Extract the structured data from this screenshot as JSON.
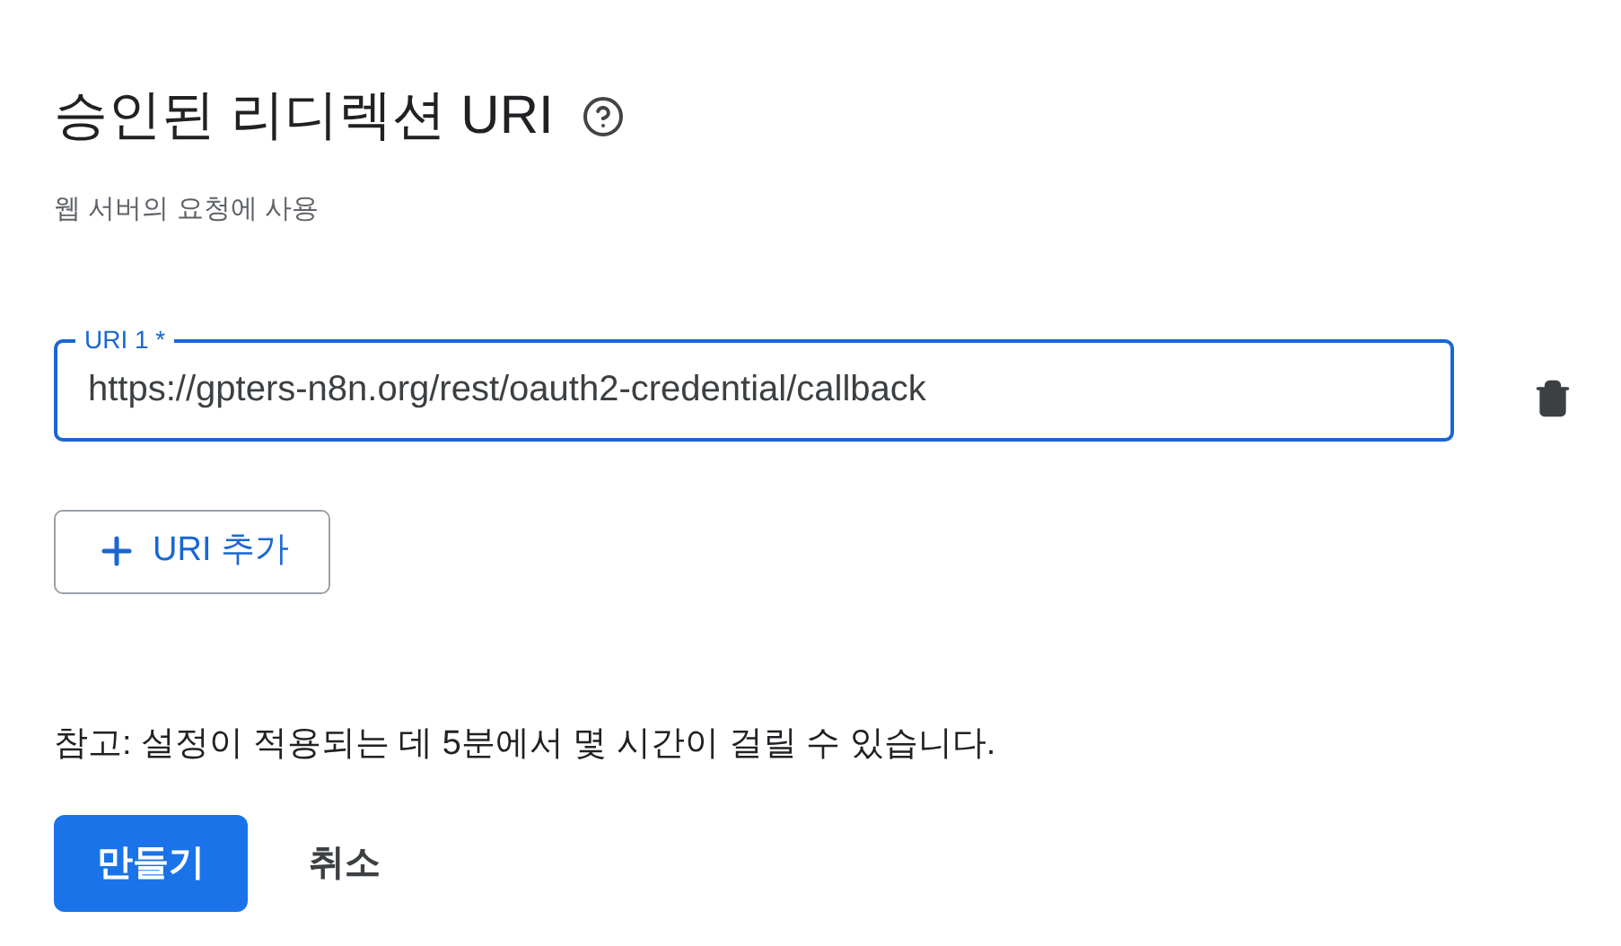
{
  "title": "승인된 리디렉션 URI",
  "subtitle": "웹 서버의 요청에 사용",
  "uris": [
    {
      "label": "URI 1 *",
      "value": "https://gpters-n8n.org/rest/oauth2-credential/callback"
    }
  ],
  "add_button": "URI 추가",
  "note": "참고: 설정이 적용되는 데 5분에서 몇 시간이 걸릴 수 있습니다.",
  "buttons": [
    {
      "label": "만들기",
      "kind": "primary"
    },
    {
      "label": "취소",
      "kind": "text"
    }
  ]
}
